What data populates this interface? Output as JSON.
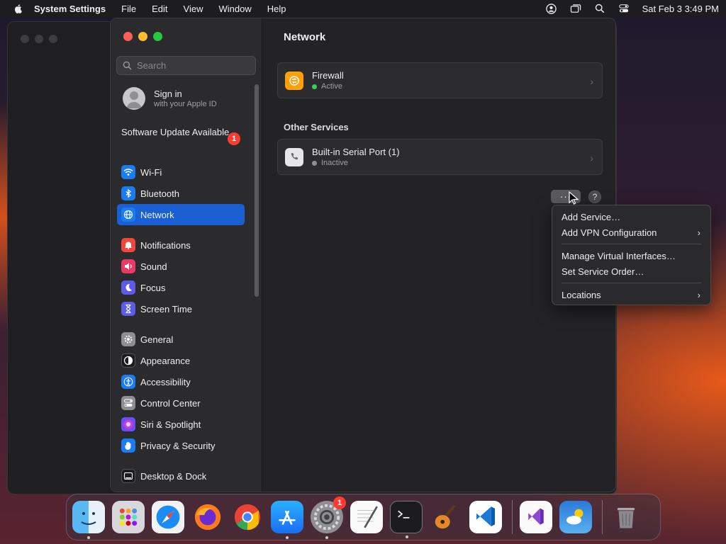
{
  "menubar": {
    "app_name": "System Settings",
    "items": [
      "File",
      "Edit",
      "View",
      "Window",
      "Help"
    ],
    "clock": "Sat Feb 3  3:49 PM"
  },
  "search": {
    "placeholder": "Search"
  },
  "account": {
    "title": "Sign in",
    "subtitle": "with your Apple ID"
  },
  "update": {
    "label": "Software Update Available",
    "badge": "1"
  },
  "sidebar": {
    "items": [
      {
        "label": "Wi-Fi",
        "icon": "wifi-icon",
        "color": "#1a7cf5"
      },
      {
        "label": "Bluetooth",
        "icon": "bluetooth-icon",
        "color": "#1a7cf5"
      },
      {
        "label": "Network",
        "icon": "globe-icon",
        "color": "#1a7cf5"
      },
      {
        "label": "Notifications",
        "icon": "bell-icon",
        "color": "#f0463c"
      },
      {
        "label": "Sound",
        "icon": "speaker-icon",
        "color": "#ea3a68"
      },
      {
        "label": "Focus",
        "icon": "moon-icon",
        "color": "#5e5ce6"
      },
      {
        "label": "Screen Time",
        "icon": "hourglass-icon",
        "color": "#5e5ce6"
      },
      {
        "label": "General",
        "icon": "gear-icon",
        "color": "#8e8e93"
      },
      {
        "label": "Appearance",
        "icon": "appearance-icon",
        "color": "#1c1c1e"
      },
      {
        "label": "Accessibility",
        "icon": "accessibility-icon",
        "color": "#1a7cf5"
      },
      {
        "label": "Control Center",
        "icon": "control-center-icon",
        "color": "#8e8e93"
      },
      {
        "label": "Siri & Spotlight",
        "icon": "siri-icon",
        "color": "#c048e0"
      },
      {
        "label": "Privacy & Security",
        "icon": "hand-icon",
        "color": "#1a7cf5"
      },
      {
        "label": "Desktop & Dock",
        "icon": "dock-icon",
        "color": "#1c1c1e"
      }
    ],
    "selected": "Network"
  },
  "content": {
    "title": "Network",
    "firewall": {
      "name": "Firewall",
      "status": "Active",
      "status_color": "#30d158"
    },
    "other_services_label": "Other Services",
    "serial": {
      "name": "Built-in Serial Port (1)",
      "status": "Inactive",
      "status_color": "#8e8e93"
    },
    "more_button": "···",
    "help_button": "?"
  },
  "dropdown": {
    "items": [
      {
        "label": "Add Service…",
        "submenu": false
      },
      {
        "label": "Add VPN Configuration",
        "submenu": true
      },
      {
        "label": "Manage Virtual Interfaces…",
        "submenu": false
      },
      {
        "label": "Set Service Order…",
        "submenu": false
      },
      {
        "label": "Locations",
        "submenu": true
      }
    ]
  },
  "dock": {
    "apps": [
      "Finder",
      "Launchpad",
      "Safari",
      "Firefox",
      "Chrome",
      "App Store",
      "System Settings",
      "TextEdit",
      "Terminal",
      "GarageBand",
      "VS Code",
      "Visual Studio",
      "Weather",
      "Trash"
    ],
    "system_settings_badge": "1"
  },
  "colors": {
    "accent": "#1a5fd4",
    "window_bg": "#232325",
    "sidebar_bg": "#2b2b2d"
  }
}
